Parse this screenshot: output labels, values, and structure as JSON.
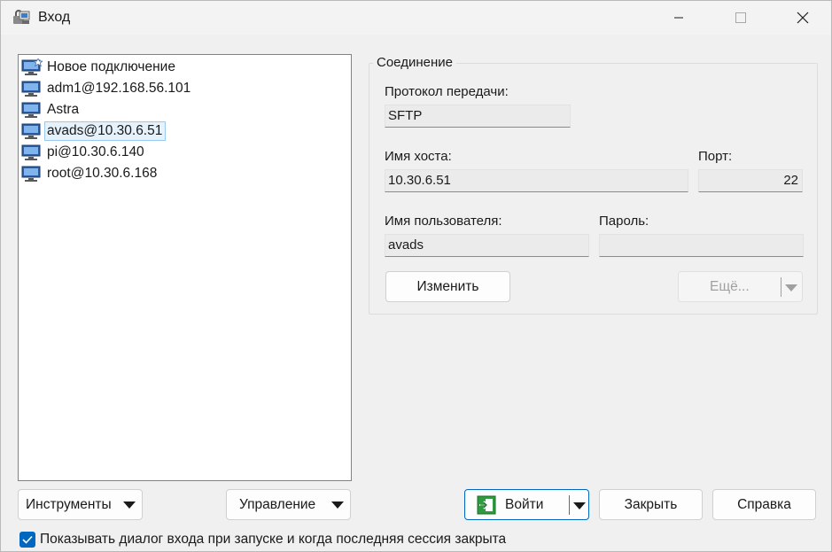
{
  "window": {
    "title": "Вход"
  },
  "sessions": [
    {
      "label": "Новое подключение",
      "icon": "new-site-icon",
      "selected": false
    },
    {
      "label": "adm1@192.168.56.101",
      "icon": "monitor-icon",
      "selected": false
    },
    {
      "label": "Astra",
      "icon": "monitor-icon",
      "selected": false
    },
    {
      "label": "avads@10.30.6.51",
      "icon": "monitor-icon",
      "selected": true
    },
    {
      "label": "pi@10.30.6.140",
      "icon": "monitor-icon",
      "selected": false
    },
    {
      "label": "root@10.30.6.168",
      "icon": "monitor-icon",
      "selected": false
    }
  ],
  "connection": {
    "group_title": "Соединение",
    "protocol_label": "Протокол передачи:",
    "protocol_value": "SFTP",
    "host_label": "Имя хоста:",
    "host_value": "10.30.6.51",
    "port_label": "Порт:",
    "port_value": "22",
    "user_label": "Имя пользователя:",
    "user_value": "avads",
    "password_label": "Пароль:",
    "password_value": "",
    "edit_button": "Изменить",
    "more_button": "Ещё..."
  },
  "footer": {
    "tools_button": "Инструменты",
    "manage_button": "Управление",
    "login_button": "Войти",
    "close_button": "Закрыть",
    "help_button": "Справка",
    "show_dialog_checkbox": "Показывать диалог входа при запуске и когда последняя сессия закрыта",
    "show_dialog_checked": true
  },
  "colors": {
    "accent": "#0067c0",
    "selection_bg": "#e5f1fb",
    "selection_border": "#99c9ef",
    "login_icon_green": "#2e9b3e"
  }
}
